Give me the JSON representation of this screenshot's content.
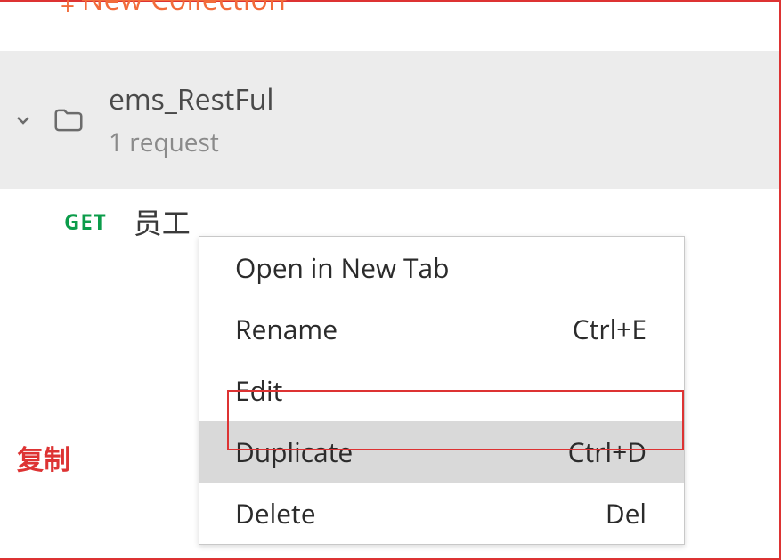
{
  "header": {
    "new_collection_label": "New Collection"
  },
  "collection": {
    "name": "ems_RestFul",
    "count_label": "1 request"
  },
  "request": {
    "method": "GET",
    "name": "员工"
  },
  "context_menu": {
    "items": [
      {
        "label": "Open in New Tab",
        "shortcut": ""
      },
      {
        "label": "Rename",
        "shortcut": "Ctrl+E"
      },
      {
        "label": "Edit",
        "shortcut": ""
      },
      {
        "label": "Duplicate",
        "shortcut": "Ctrl+D"
      },
      {
        "label": "Delete",
        "shortcut": "Del"
      }
    ]
  },
  "annotation": {
    "text": "复制"
  }
}
